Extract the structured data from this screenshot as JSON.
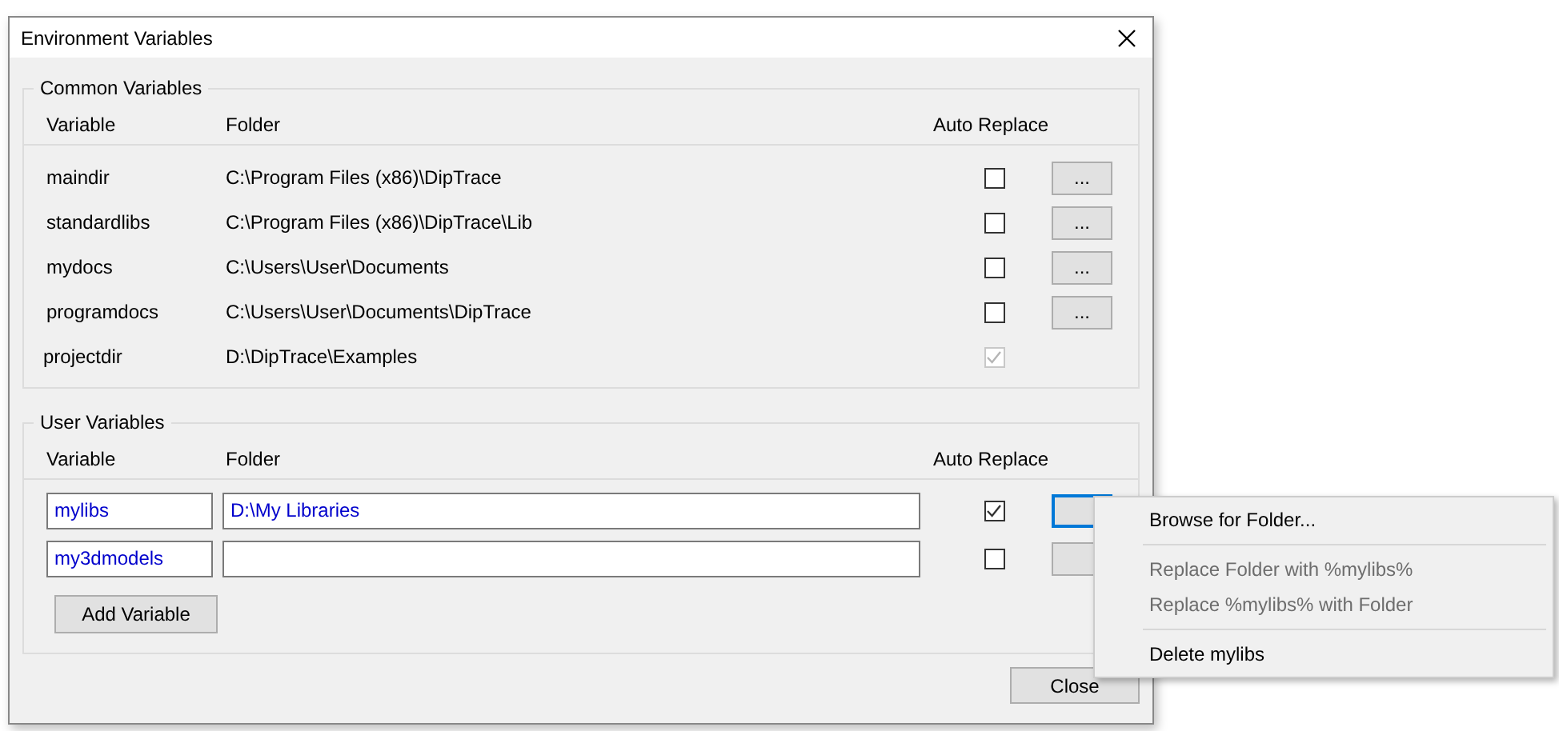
{
  "window": {
    "title": "Environment Variables"
  },
  "common_variables": {
    "title": "Common Variables",
    "columns": [
      "Variable",
      "Folder",
      "Auto Replace"
    ],
    "rows": [
      {
        "variable": "maindir",
        "folder": "C:\\Program Files (x86)\\DipTrace",
        "auto_replace": false,
        "disabled": false,
        "browse_label": "..."
      },
      {
        "variable": "standardlibs",
        "folder": "C:\\Program Files (x86)\\DipTrace\\Lib",
        "auto_replace": false,
        "disabled": false,
        "browse_label": "..."
      },
      {
        "variable": "mydocs",
        "folder": "C:\\Users\\User\\Documents",
        "auto_replace": false,
        "disabled": false,
        "browse_label": "..."
      },
      {
        "variable": "programdocs",
        "folder": "C:\\Users\\User\\Documents\\DipTrace",
        "auto_replace": false,
        "disabled": false,
        "browse_label": "..."
      },
      {
        "variable": "projectdir",
        "folder": "D:\\DipTrace\\Examples",
        "auto_replace": true,
        "disabled": true
      }
    ]
  },
  "user_variables": {
    "title": "User Variables",
    "columns": [
      "Variable",
      "Folder",
      "Auto Replace"
    ],
    "rows": [
      {
        "variable": "mylibs",
        "folder": "D:\\My Libraries",
        "auto_replace": true,
        "focused": true
      },
      {
        "variable": "my3dmodels",
        "auto_replace": false,
        "focused": false
      }
    ],
    "add_button": "Add Variable"
  },
  "close_button": "Close",
  "context_menu": {
    "items": [
      {
        "kind": "item",
        "label": "Browse for Folder...",
        "disabled": false
      },
      {
        "kind": "separator"
      },
      {
        "kind": "item",
        "label": "Replace Folder with %mylibs%",
        "disabled": true
      },
      {
        "kind": "item",
        "label": "Replace %mylibs% with Folder",
        "disabled": true
      },
      {
        "kind": "separator"
      },
      {
        "kind": "item",
        "label": "Delete mylibs",
        "disabled": false
      }
    ]
  }
}
